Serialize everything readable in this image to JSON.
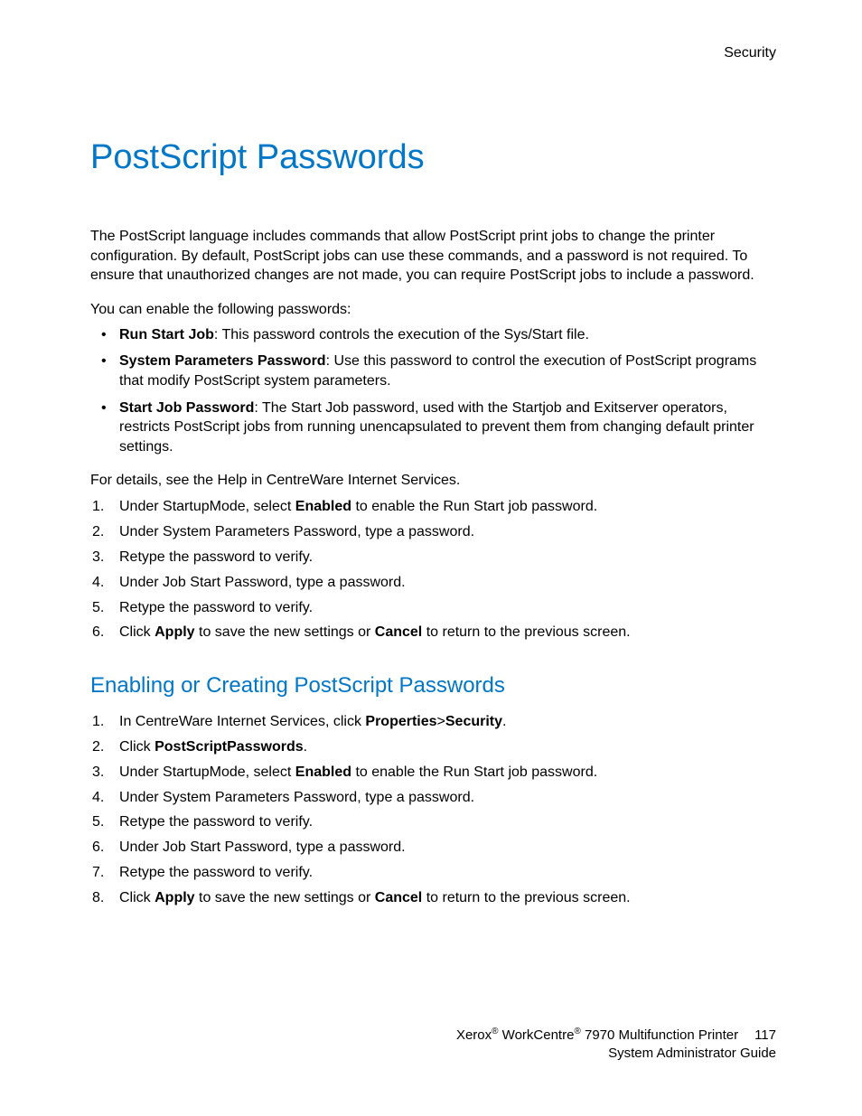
{
  "header": {
    "section": "Security"
  },
  "h1": "PostScript Passwords",
  "intro": "The PostScript language includes commands that allow PostScript print jobs to change the printer configuration. By default, PostScript jobs can use these commands, and a password is not required. To ensure that unauthorized changes are not made, you can require PostScript jobs to include a password.",
  "enable_text": "You can enable the following passwords:",
  "bullets": [
    {
      "boldLabel": "Run Start Job",
      "text": ": This password controls the execution of the Sys/Start file."
    },
    {
      "boldLabel": "System Parameters Password",
      "text": ": Use this password to control the execution of PostScript programs that modify PostScript system parameters."
    },
    {
      "boldLabel": "Start Job Password",
      "text": ": The Start Job password, used with the Startjob and Exitserver operators, restricts PostScript jobs from running unencapsulated to prevent them from changing default printer settings."
    }
  ],
  "details_text": "For details, see the Help in CentreWare Internet Services.",
  "steps_a": {
    "s1_a": "Under StartupMode, select ",
    "s1_b": "Enabled",
    "s1_c": " to enable the Run Start job password.",
    "s2": "Under System Parameters Password, type a password.",
    "s3": "Retype the password to verify.",
    "s4": "Under Job Start Password, type a password.",
    "s5": "Retype the password to verify.",
    "s6_a": "Click ",
    "s6_b": "Apply",
    "s6_c": " to save the new settings or ",
    "s6_d": "Cancel",
    "s6_e": " to return to the previous screen."
  },
  "h2": "Enabling or Creating PostScript Passwords",
  "steps_b": {
    "s1_a": "In CentreWare Internet Services, click ",
    "s1_b": "Properties",
    "s1_c": ">",
    "s1_d": "Security",
    "s1_e": ".",
    "s2_a": "Click ",
    "s2_b": "PostScriptPasswords",
    "s2_c": ".",
    "s3_a": "Under StartupMode, select ",
    "s3_b": "Enabled",
    "s3_c": " to enable the Run Start job password.",
    "s4": "Under System Parameters Password, type a password.",
    "s5": "Retype the password to verify.",
    "s6": "Under Job Start Password, type a password.",
    "s7": "Retype the password to verify.",
    "s8_a": "Click ",
    "s8_b": "Apply",
    "s8_c": " to save the new settings or ",
    "s8_d": "Cancel",
    "s8_e": " to return to the previous screen."
  },
  "footer": {
    "brand1": "Xerox",
    "reg": "®",
    "brand2": " WorkCentre",
    "model": " 7970 Multifunction Printer",
    "page": "117",
    "line2": "System Administrator Guide"
  }
}
